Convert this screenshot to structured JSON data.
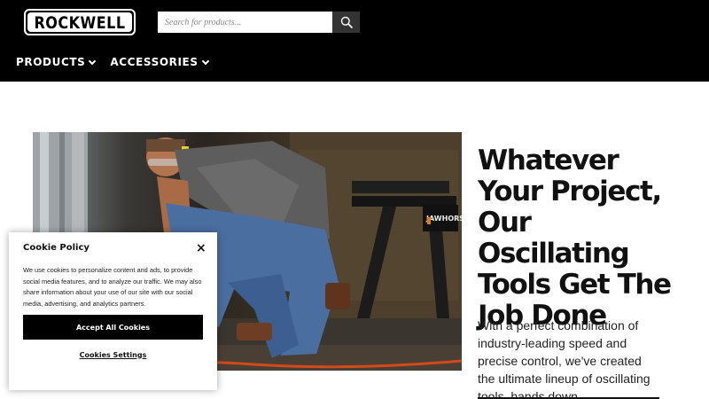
{
  "header": {
    "logo_text": "ROCKWELL",
    "search": {
      "placeholder": "Search for products...",
      "icon": "search-icon"
    },
    "nav": [
      {
        "label": "PRODUCTS",
        "icon": "chevron-down-icon"
      },
      {
        "label": "ACCESSORIES",
        "icon": "chevron-down-icon"
      }
    ]
  },
  "hero": {
    "image_label": "JAWHORSE"
  },
  "main": {
    "headline": "Whatever Your Project, Our Oscillating Tools Get The Job Done",
    "body": "With a perfect combination of industry-leading speed and precise control, we've created the ultimate lineup of oscillating tools, hands down."
  },
  "cookie": {
    "title": "Cookie Policy",
    "close_icon": "close-icon",
    "close_label": "×",
    "text": "We use cookies to personalize content and ads, to provide social media features, and to analyze our traffic. We may also share information about your use of our site with our social media, advertising, and analytics partners.",
    "accept_label": "Accept All Cookies",
    "settings_label": "Cookies Settings"
  },
  "colors": {
    "header_bg": "#000000",
    "search_button_bg": "#333333",
    "accept_bg": "#000000"
  }
}
